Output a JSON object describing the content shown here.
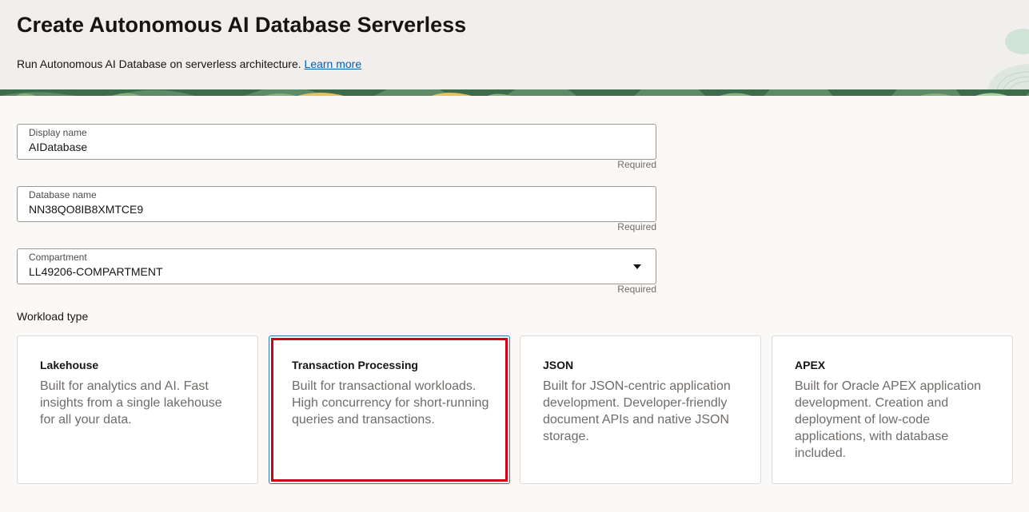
{
  "header": {
    "title": "Create Autonomous AI Database Serverless",
    "subtitle": "Run Autonomous AI Database on serverless architecture.",
    "learn_more": "Learn more"
  },
  "form": {
    "display_name": {
      "label": "Display name",
      "value": "AIDatabase",
      "hint": "Required"
    },
    "database_name": {
      "label": "Database name",
      "value": "NN38QO8IB8XMTCE9",
      "hint": "Required"
    },
    "compartment": {
      "label": "Compartment",
      "value": "LL49206-COMPARTMENT",
      "hint": "Required"
    },
    "workload_type": {
      "label": "Workload type",
      "selected": "Transaction Processing",
      "options": [
        {
          "title": "Lakehouse",
          "description": "Built for analytics and AI. Fast insights from a single lakehouse for all your data."
        },
        {
          "title": "Transaction Processing",
          "description": "Built for transactional workloads. High concurrency for short-running queries and transactions."
        },
        {
          "title": "JSON",
          "description": "Built for JSON-centric application development. Developer-friendly document APIs and native JSON storage."
        },
        {
          "title": "APEX",
          "description": "Built for Oracle APEX application development. Creation and deployment of low-code applications, with database included."
        }
      ]
    }
  },
  "colors": {
    "header_bg": "#f1efed",
    "banner_green": "#3f6b4d",
    "link": "#0d5ea8",
    "selection_highlight": "#d0021b",
    "selected_border": "#3a75b0"
  }
}
